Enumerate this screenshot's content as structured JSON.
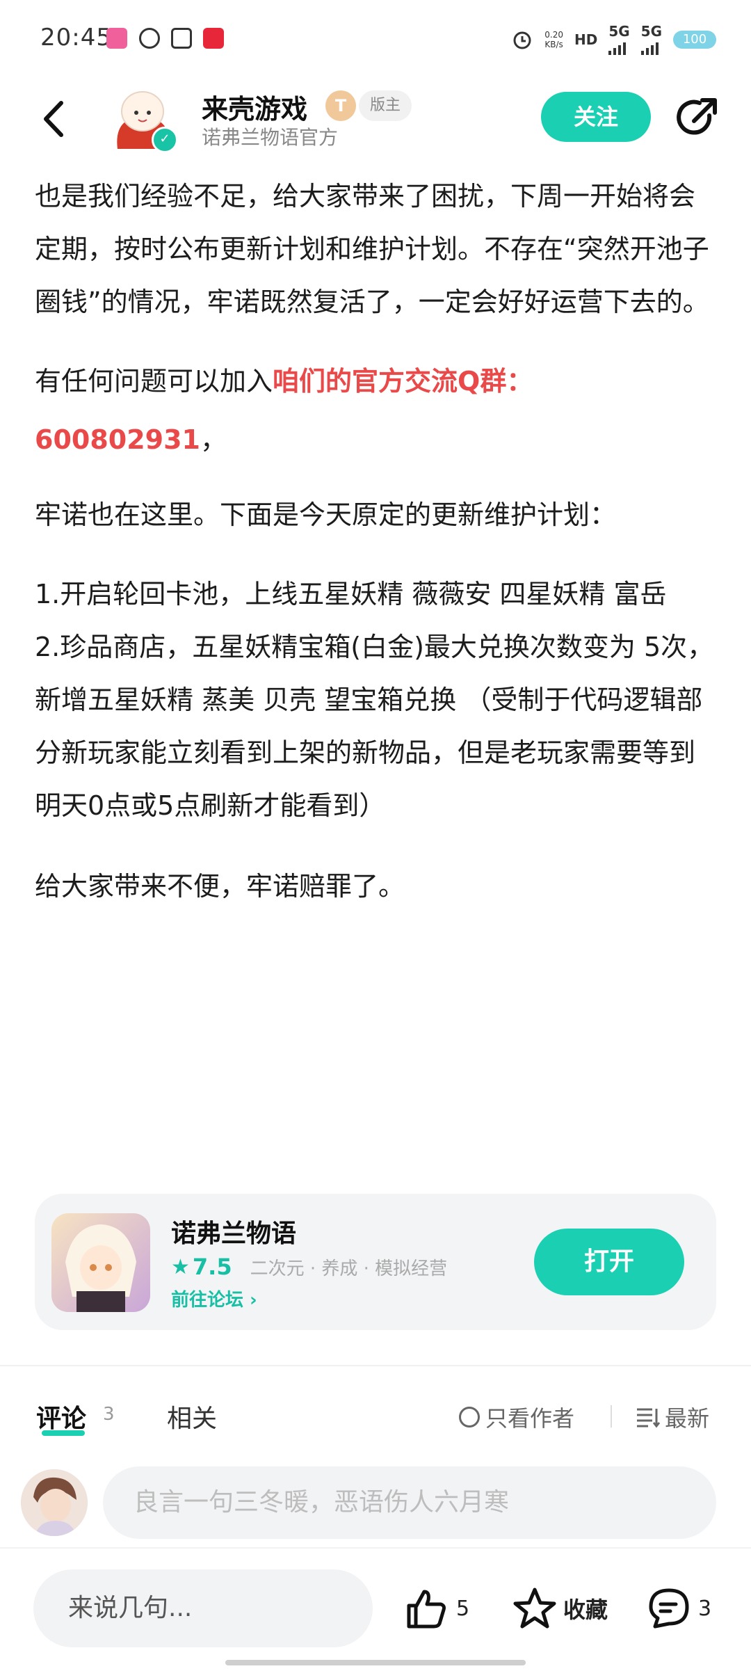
{
  "status_bar": {
    "time": "20:45",
    "network_speed": "0.20",
    "network_speed_unit": "KB/s",
    "hd": "HD",
    "net1": "5G",
    "net2": "5G",
    "battery": "100"
  },
  "header": {
    "author_name": "来壳游戏",
    "level_badge": "T",
    "role_badge": "版主",
    "author_sub": "诺弗兰物语官方",
    "follow_label": "关注"
  },
  "article": {
    "p1": "也是我们经验不足，给大家带来了困扰，下周一开始将会定期，按时公布更新计划和维护计划。不存在“突然开池子圈钱”的情况，牢诺既然复活了，一定会好好运营下去的。",
    "p2_prefix": "有任何问题可以加入",
    "p2_highlight": "咱们的官方交流Q群：600802931",
    "p2_suffix": "，",
    "p3": "牢诺也在这里。下面是今天原定的更新维护计划：",
    "p4_line1": "1.开启轮回卡池，上线五星妖精 薇薇安 四星妖精 富岳",
    "p4_line2": "2.珍品商店，五星妖精宝箱(白金)最大兑换次数变为 5次，新增五星妖精 蒸美 贝壳 望宝箱兑换 （受制于代码逻辑部分新玩家能立刻看到上架的新物品，但是老玩家需要等到明天0点或5点刷新才能看到）",
    "p5": "给大家带来不便，牢诺赔罪了。"
  },
  "game_card": {
    "title": "诺弗兰物语",
    "rating": "7.5",
    "tags": "二次元 · 养成 · 模拟经营",
    "forum_link": "前往论坛 ›",
    "open_label": "打开"
  },
  "tabs": {
    "comments_label": "评论",
    "comments_count": "3",
    "related_label": "相关",
    "author_only_label": "只看作者",
    "sort_label": "最新"
  },
  "comment_input": {
    "placeholder": "良言一句三冬暖，恶语伤人六月寒"
  },
  "bottom_bar": {
    "quick_input": "来说几句...",
    "likes": "5",
    "favorite_label": "收藏",
    "comments": "3"
  },
  "colors": {
    "accent": "#1bd0b2",
    "highlight": "#e94949"
  }
}
